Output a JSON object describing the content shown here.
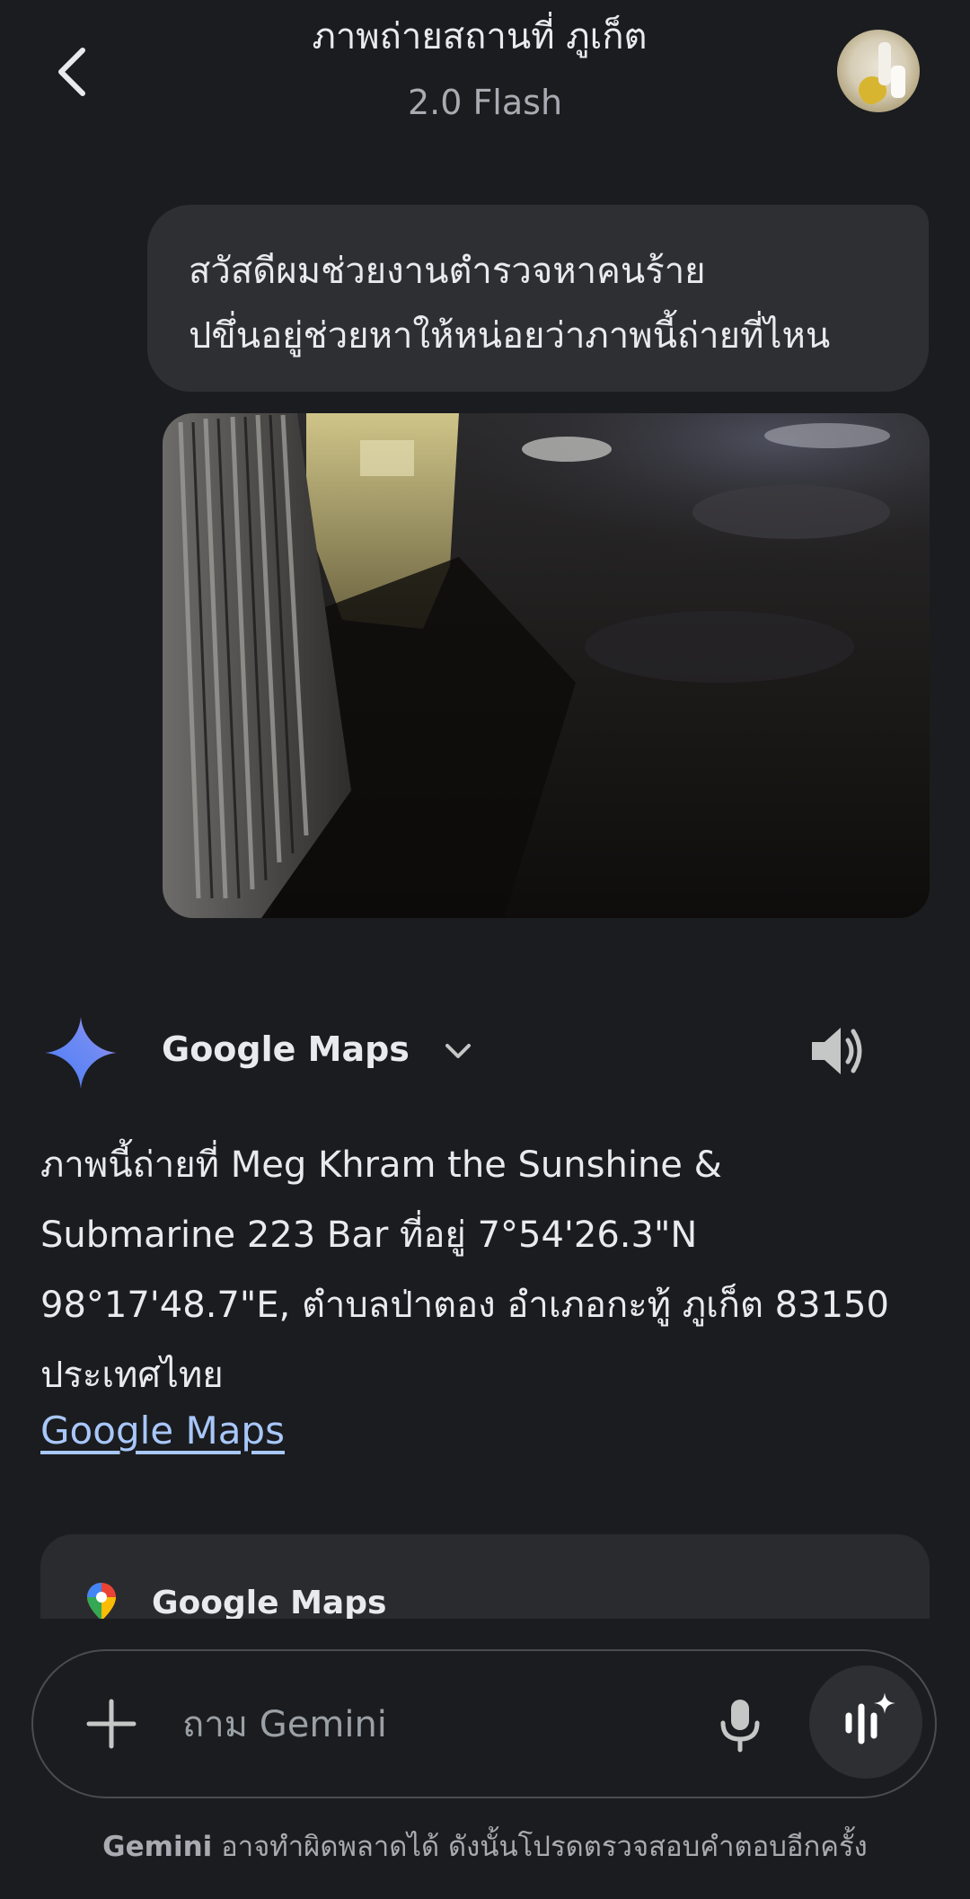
{
  "header": {
    "title": "ภาพถ่ายสถานที่ ภูเก็ต",
    "model": "2.0 Flash"
  },
  "user_message": {
    "lines": [
      "สวัสดีผมช่วยงานตำรวจหาคนร้าย",
      "ปขึ่นอยู่ช่วยหาให้หน่อยว่าภาพนี้ถ่ายที่ไหน"
    ]
  },
  "response": {
    "source_label": "Google Maps",
    "lines": [
      "ภาพนี้ถ่ายที่ Meg Khram the Sunshine &",
      "Submarine 223 Bar ที่อยู่ 7°54'26.3\"N",
      "98°17'48.7\"E, ตำบลป่าตอง อำเภอกะทู้ ภูเก็ต 83150",
      "ประเทศไทย"
    ],
    "link_text": "Google Maps"
  },
  "maps_card": {
    "title": "Google Maps"
  },
  "input": {
    "placeholder": "ถาม Gemini"
  },
  "disclaimer": {
    "brand": "Gemini",
    "text": " อาจทำผิดพลาดได้ ดังนั้นโปรดตรวจสอบคำตอบอีกครั้ง"
  },
  "icons": {
    "back": "chevron-left-icon",
    "source": "gemini-sparkle-icon",
    "expand": "chevron-down-icon",
    "read_aloud": "speaker-icon",
    "maps": "google-maps-pin-icon",
    "add": "plus-icon",
    "mic": "microphone-icon",
    "live": "gemini-live-icon"
  },
  "colors": {
    "background": "#1b1c1f",
    "bubble": "#2e2f33",
    "link": "#a8c7fa",
    "muted_text": "#a8abb1"
  }
}
